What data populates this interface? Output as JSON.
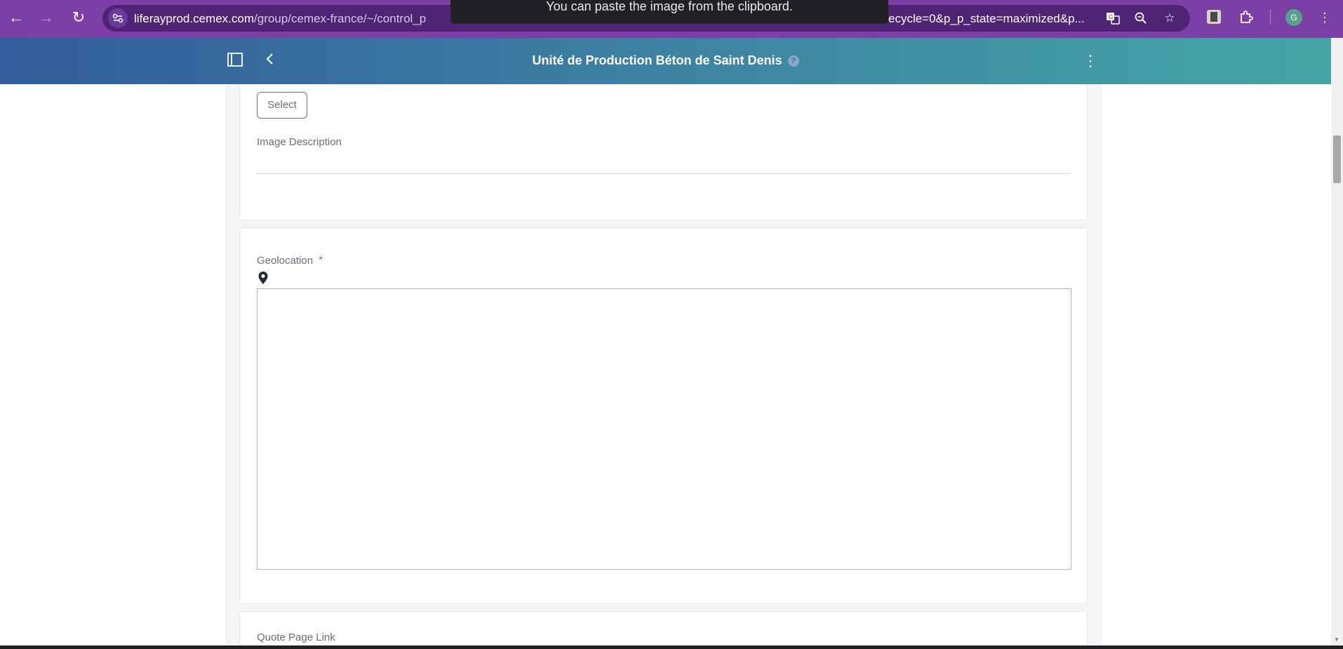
{
  "browser": {
    "url_host": "liferayprod.cemex.com",
    "url_path": "/group/cemex-france/~/control_p",
    "url_tail": "ecycle=0&p_p_state=maximized&p...",
    "avatar_letter": "G",
    "toast": "You can paste the image from the clipboard.",
    "icons": {
      "back": "arrow-left-icon",
      "forward": "arrow-right-icon",
      "reload": "reload-icon",
      "site_info": "site-info-icon",
      "translate": "translate-icon",
      "zoom": "zoom-icon",
      "bookmark": "star-icon",
      "extension": "puzzle-icon",
      "menu": "kebab-menu-icon"
    }
  },
  "header": {
    "title": "Unité de Production Béton de Saint Denis"
  },
  "form": {
    "select_button": "Select",
    "image_description_label": "Image Description",
    "geolocation_label": "Geolocation",
    "required_mark": "*",
    "quote_page_link_label": "Quote Page Link"
  },
  "colors": {
    "chrome_purple": "#7b3fa6",
    "header_gradient_start": "#325c9c",
    "header_gradient_end": "#44a5a6",
    "required_orange": "#e06a1e"
  }
}
